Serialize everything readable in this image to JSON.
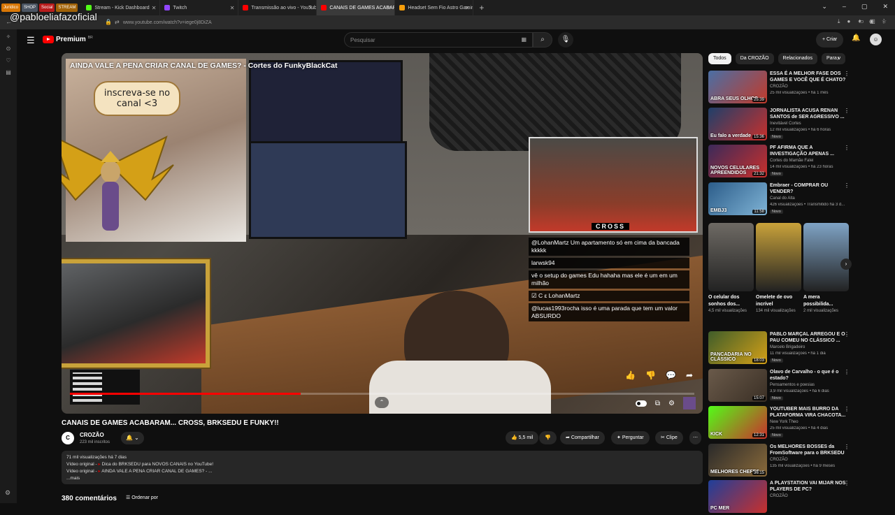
{
  "browser": {
    "bookmarks": [
      {
        "label": "Jurídico",
        "color": "#d97706"
      },
      {
        "label": "SHOP",
        "color": "#4b5563"
      },
      {
        "label": "Social",
        "color": "#b91c1c"
      },
      {
        "label": "STREAM",
        "color": "#a16207"
      }
    ],
    "tabs": [
      {
        "label": "Stream - Kick Dashboard",
        "favicon_color": "#53fc18"
      },
      {
        "label": "Twitch",
        "favicon_color": "#9146ff"
      },
      {
        "label": "Transmissão ao vivo - YouTube",
        "favicon_color": "#ff0000"
      },
      {
        "label": "CANAIS DE GAMES ACABARAM...",
        "favicon_color": "#ff0000"
      },
      {
        "label": "Headset Sem Fio Astro Gaming",
        "favicon_color": "#f59e0b"
      }
    ],
    "url": "www.youtube.com/watch?v=iege0j8DiZA",
    "overlay_handle": "@pabloeliafazoficial"
  },
  "header": {
    "brand": "Premium",
    "brand_sup": "BR",
    "search_placeholder": "Pesquisar",
    "create_label": "Criar",
    "avatar_initial": "☺"
  },
  "player": {
    "video_overlay_title": "AINDA VALE A PENA CRIAR CANAL DE GAMES? - Cortes do FunkyBlackCat",
    "speech_bubble": "inscreva-se no canal <3",
    "cam_tag": "CROSS",
    "chat": [
      "@LohanMartz Um apartamento só em cima da bancada kkkkk",
      "larwsk94",
      "vê o setup do games Edu hahaha mas ele é um em um milhão",
      "☑ C ε LohanMartz",
      "@lucas1993rocha isso é uma parada que tem um valor ABSURDO"
    ],
    "progress_pct": 37
  },
  "video": {
    "title": "CANAIS DE GAMES ACABARAM... CROSS, BRKSEDU E FUNKY!!",
    "channel_name": "CROZÃO",
    "channel_subs": "223 mil inscritos",
    "likes": "5,5 mil",
    "share": "Compartilhar",
    "ask": "Perguntar",
    "clip": "Clipe",
    "desc_stats": "71 mil visualizações  há 7 dias",
    "desc_line1_prefix": "Vídeo original -",
    "desc_line1_link": "Dica do BRKSEDU para NOVOS CANAIS no YouTube!",
    "desc_line2_prefix": "Vídeo original -",
    "desc_line2_link": "AINDA VALE A PENA CRIAR CANAL DE GAMES? - ...",
    "desc_more": "...mais",
    "comments_count": "380 comentários",
    "sort_label": "Ordenar por"
  },
  "sidebar": {
    "chips": [
      "Todos",
      "Da CROZÃO",
      "Relacionados",
      "Para v"
    ],
    "recs": [
      {
        "title": "ESSA É A MELHOR FASE DOS GAMES E VOCÊ QUE É CHATO?",
        "channel": "CROZÃO",
        "meta": "25 mil visualizações • há 1 mês",
        "duration": "25:39",
        "thumb_text": "ABRA SEUS OLHOS",
        "badge": "",
        "colors": [
          "#4a6fa5",
          "#c23a2a"
        ]
      },
      {
        "title": "JORNALISTA ACUSA RENAN SANTOS de SER AGRESSIVO ...",
        "channel": "Inevitável Cortes",
        "meta": "12 mil visualizações • há 6 horas",
        "duration": "15:36",
        "thumb_text": "Eu falo a verdade",
        "badge": "Novo",
        "colors": [
          "#1f3f6a",
          "#c9302c"
        ]
      },
      {
        "title": "PF AFIRMA QUE A INVESTIGAÇÃO APENAS ...",
        "channel": "Cortes do Mamãe Falei",
        "meta": "14 mil visualizações • há 23 horas",
        "duration": "21:32",
        "thumb_text": "NOVOS CELULARES APREENDIDOS",
        "badge": "Novo",
        "colors": [
          "#3b2a5a",
          "#c9302c"
        ]
      },
      {
        "title": "Embraer - COMPRAR OU VENDER?",
        "channel": "Canal do Alta",
        "meta": "426 visualizações • Transmitido há 3 d...",
        "duration": "11:58",
        "thumb_text": "EMBJ3",
        "badge": "Novo",
        "colors": [
          "#2c5d8a",
          "#7fb3d5"
        ]
      },
      {
        "title": "PABLO MARÇAL ARREGOU E O PAU COMEU NO CLÁSSICO ...",
        "channel": "Marcelo Brigadeiro",
        "meta": "11 mil visualizações • há 1 dia",
        "duration": "18:03",
        "thumb_text": "PANCADARIA NO CLÁSSICO",
        "badge": "Novo",
        "colors": [
          "#3f5d2a",
          "#d4a017"
        ]
      },
      {
        "title": "Olavo de Carvalho - o que é o estado?",
        "channel": "Pensamentos e poesias",
        "meta": "3,9 mil visualizações • há 6 dias",
        "duration": "15:07",
        "thumb_text": "",
        "badge": "Novo",
        "colors": [
          "#6a5a4a",
          "#3a2f25"
        ]
      },
      {
        "title": "YOUTUBER MAIS BURRO DA PLATAFORMA VIRA CHACOTA...",
        "channel": "New York Theo",
        "meta": "25 mil visualizações • há 4 dias",
        "duration": "12:31",
        "thumb_text": "KICK",
        "badge": "Novo",
        "colors": [
          "#53fc18",
          "#c9302c"
        ]
      },
      {
        "title": "Os MELHORES BOSSES da FromSoftware para o BRKSEDU",
        "channel": "CROZÃO",
        "meta": "135 mil visualizações • há 9 meses",
        "duration": "36:15",
        "thumb_text": "MELHORES CHEFES",
        "badge": "",
        "colors": [
          "#2a2a2a",
          "#8a6a3a"
        ]
      },
      {
        "title": "A PLAYSTATION VAI MIJAR NOS PLAYERS DE PC?",
        "channel": "CROZÃO",
        "meta": "",
        "duration": "",
        "thumb_text": "PC MER",
        "badge": "",
        "colors": [
          "#1f3f9a",
          "#c9302c"
        ]
      }
    ],
    "shorts": [
      {
        "title": "O celular dos sonhos dos...",
        "views": "4,5 mil visualizações",
        "color": "#6e6a64"
      },
      {
        "title": "Omelete de ovo incrível",
        "views": "134 mil visualizações",
        "color": "#c9a23a"
      },
      {
        "title": "A mera possibilida...",
        "views": "2 mil visualizações",
        "color": "#7fa3c5"
      }
    ]
  }
}
